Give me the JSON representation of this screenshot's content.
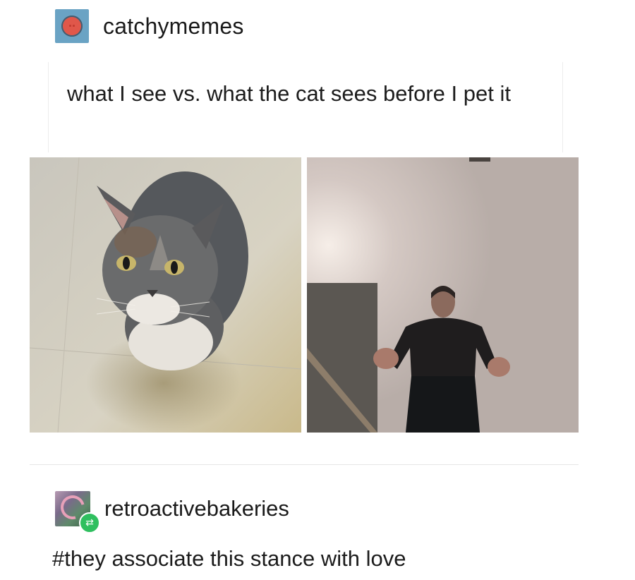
{
  "post": {
    "author": "catchymemes",
    "author_avatar": "orange-face-icon",
    "caption": "what I see vs. what the cat sees before I pet it",
    "images": {
      "left": "grey-and-white-cat-looking-up-photo",
      "right": "low-angle-man-standing-photo"
    }
  },
  "reblog": {
    "author": "retroactivebakeries",
    "author_avatar": "swirl-art-avatar",
    "badge_icon": "reblog-icon",
    "tags": "#they associate this stance with love"
  },
  "colors": {
    "reblog_badge": "#2fbf5f",
    "avatar_bg": "#6aa3c4",
    "avatar_face": "#e0574a"
  }
}
